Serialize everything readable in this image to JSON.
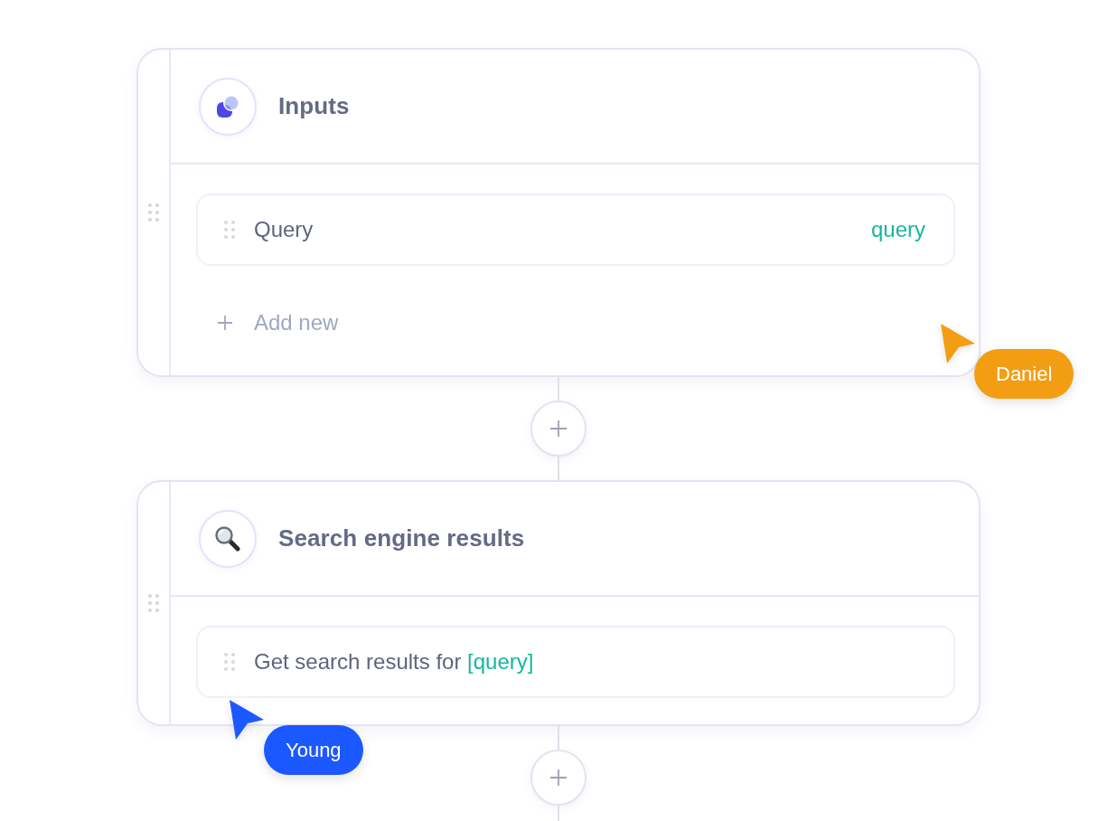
{
  "blocks": [
    {
      "kind": "inputs",
      "title": "Inputs",
      "fields": [
        {
          "kind": "variable",
          "label": "Query",
          "variable": "query"
        }
      ],
      "add_new": "Add new"
    },
    {
      "kind": "search",
      "title": "Search engine results",
      "fields": [
        {
          "kind": "prompt",
          "text": "Get search results for",
          "variable": "[query]"
        }
      ]
    }
  ],
  "cursors": [
    {
      "name": "Daniel",
      "color": "#f39e12"
    },
    {
      "name": "Young",
      "color": "#1c58ff"
    }
  ]
}
